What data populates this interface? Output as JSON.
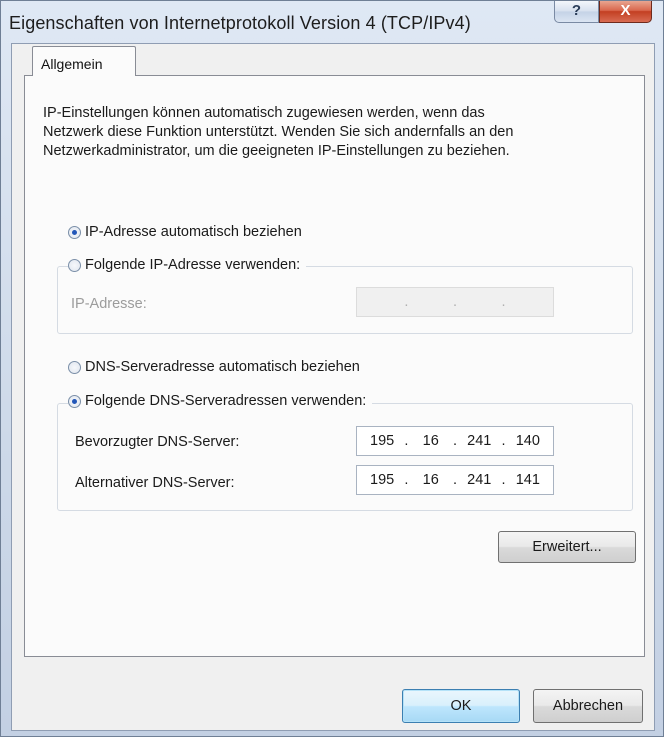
{
  "window": {
    "title": "Eigenschaften von Internetprotokoll Version 4 (TCP/IPv4)",
    "help_label": "?",
    "close_label": "X"
  },
  "tabs": [
    {
      "label": "Allgemein",
      "selected": true
    }
  ],
  "info_lines": [
    "IP-Einstellungen können automatisch zugewiesen werden, wenn das",
    "Netzwerk diese Funktion unterstützt. Wenden Sie sich andernfalls an den",
    "Netzwerkadministrator, um die geeigneten IP-Einstellungen zu beziehen."
  ],
  "ip_section": {
    "auto_label": "IP-Adresse automatisch beziehen",
    "auto_checked": true,
    "manual_label": "Folgende IP-Adresse verwenden:",
    "manual_checked": false,
    "ip_address_label": "IP-Adresse:",
    "ip_address_octets": [
      "",
      "",
      "",
      ""
    ]
  },
  "dns_section": {
    "auto_label": "DNS-Serveradresse automatisch beziehen",
    "auto_checked": false,
    "manual_label": "Folgende DNS-Serveradressen verwenden:",
    "manual_checked": true,
    "preferred_label": "Bevorzugter DNS-Server:",
    "preferred_octets": [
      "195",
      "16",
      "241",
      "140"
    ],
    "alternate_label": "Alternativer DNS-Server:",
    "alternate_octets": [
      "195",
      "16",
      "241",
      "141"
    ]
  },
  "buttons": {
    "advanced": "Erweitert...",
    "ok": "OK",
    "cancel": "Abbrechen"
  },
  "colors": {
    "accent_radio": "#2256b8",
    "close_button": "#c33f22"
  }
}
